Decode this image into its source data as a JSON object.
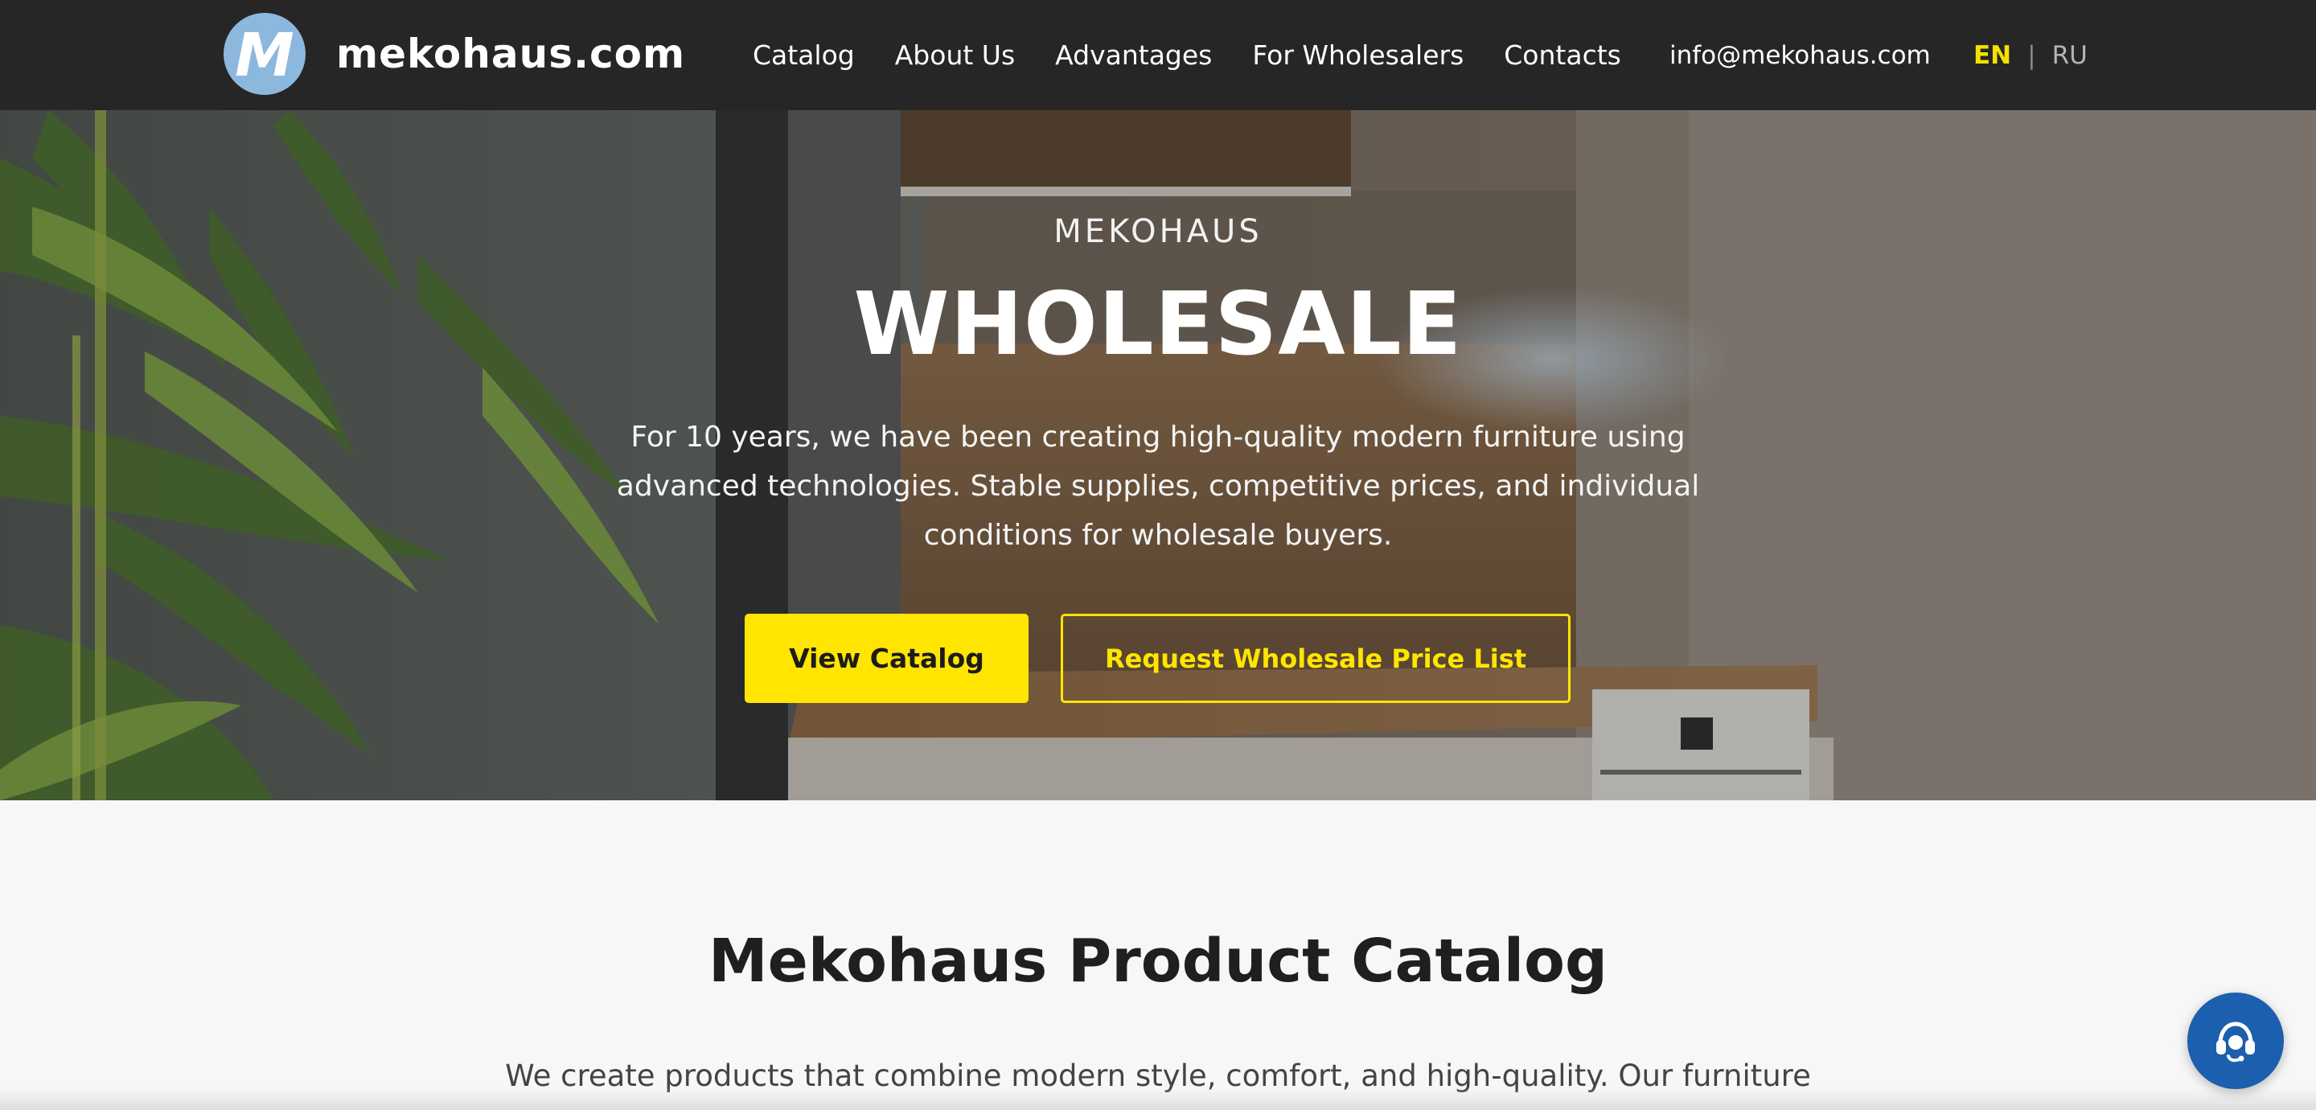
{
  "header": {
    "logo_letter": "M",
    "site_name": "mekohaus.com",
    "nav": [
      "Catalog",
      "About Us",
      "Advantages",
      "For Wholesalers",
      "Contacts"
    ],
    "email": "info@mekohaus.com",
    "lang_active": "EN",
    "lang_separator": "|",
    "lang_other": "RU"
  },
  "hero": {
    "kicker": "MEKOHAUS",
    "title": "WHOLESALE",
    "description": "For 10 years, we have been creating high-quality modern furniture using advanced technologies. Stable supplies, competitive prices, and individual conditions for wholesale buyers.",
    "primary_button": "View Catalog",
    "secondary_button": "Request Wholesale Price List"
  },
  "catalog": {
    "title": "Mekohaus Product Catalog",
    "description": "We create products that combine modern style, comfort, and high-quality. Our furniture"
  },
  "icons": {
    "support": "headset-icon"
  },
  "colors": {
    "header_bg": "#262626",
    "accent_yellow": "#ffe500",
    "logo_badge": "#8db8de",
    "support_button": "#1c5fae"
  }
}
